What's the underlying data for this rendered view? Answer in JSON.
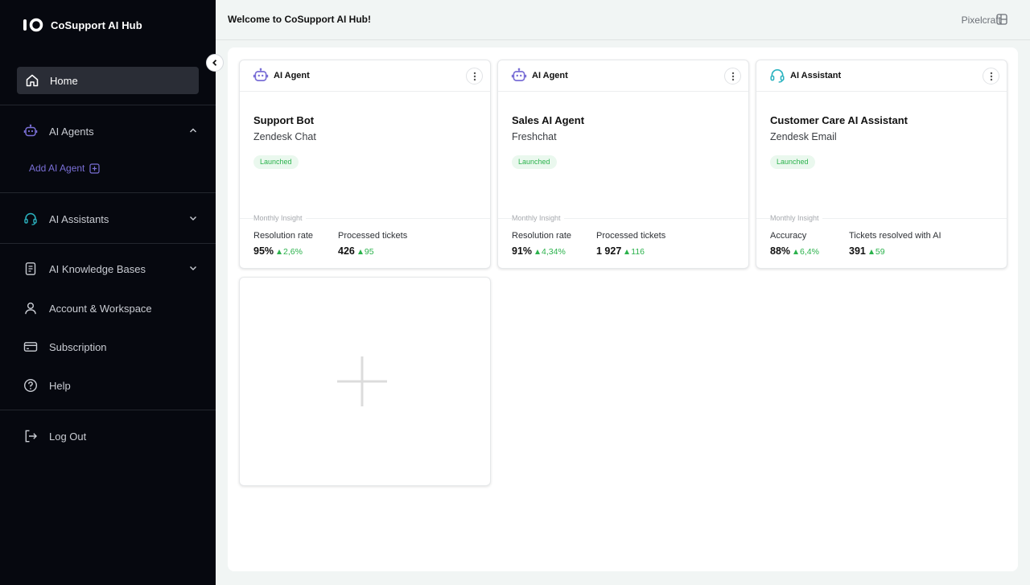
{
  "app": {
    "name": "CoSupport AI Hub"
  },
  "sidebar": {
    "home": "Home",
    "ai_agents": "AI Agents",
    "add_ai_agent": "Add AI Agent",
    "ai_assistants": "AI Assistants",
    "ai_knowledge_bases": "AI Knowledge Bases",
    "account_workspace": "Account & Workspace",
    "subscription": "Subscription",
    "help": "Help",
    "log_out": "Log Out"
  },
  "header": {
    "welcome": "Welcome to CoSupport AI Hub!",
    "workspace": "Pixelcraft"
  },
  "cards": [
    {
      "type": "AI Agent",
      "title": "Support Bot",
      "channel": "Zendesk Chat",
      "status": "Launched",
      "insight_label": "Monthly Insight",
      "metric1_label": "Resolution rate",
      "metric1_value": "95%",
      "metric1_delta": "2,6%",
      "metric2_label": "Processed tickets",
      "metric2_value": "426",
      "metric2_delta": "95"
    },
    {
      "type": "AI Agent",
      "title": "Sales AI Agent",
      "channel": "Freshchat",
      "status": "Launched",
      "insight_label": "Monthly Insight",
      "metric1_label": "Resolution rate",
      "metric1_value": "91%",
      "metric1_delta": "4,34%",
      "metric2_label": "Processed tickets",
      "metric2_value": "1 927",
      "metric2_delta": "116"
    },
    {
      "type": "AI Assistant",
      "title": "Customer Care AI Assistant",
      "channel": "Zendesk Email",
      "status": "Launched",
      "insight_label": "Monthly Insight",
      "metric1_label": "Accuracy",
      "metric1_value": "88%",
      "metric1_delta": "6,4%",
      "metric2_label": "Tickets resolved with AI",
      "metric2_value": "391",
      "metric2_delta": "59"
    }
  ],
  "colors": {
    "sidebar_bg": "#06080f",
    "accent_purple": "#7a6fd6",
    "accent_teal": "#2bb3c0",
    "success_green": "#2bb24c"
  },
  "icons": {
    "agent": "robot-icon",
    "assistant": "headset-icon",
    "add": "plus-icon"
  }
}
